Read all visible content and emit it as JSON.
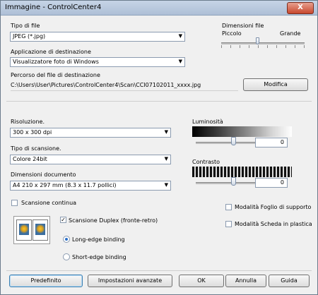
{
  "window": {
    "title": "Immagine - ControlCenter4",
    "close_label": "X"
  },
  "file_type": {
    "label": "Tipo di file",
    "value": "JPEG (*.jpg)"
  },
  "file_size": {
    "label": "Dimensioni file",
    "small": "Piccolo",
    "large": "Grande"
  },
  "target_app": {
    "label": "Applicazione di destinazione",
    "value": "Visualizzatore foto di Windows"
  },
  "dest_path": {
    "label": "Percorso del file di destinazione",
    "value": "C:\\Users\\User\\Pictures\\ControlCenter4\\Scan\\CCI07102011_xxxx.jpg",
    "modify_button": "Modifica"
  },
  "resolution": {
    "label": "Risoluzione.",
    "value": "300 x 300 dpi"
  },
  "scan_type": {
    "label": "Tipo di scansione.",
    "value": "Colore 24bit"
  },
  "doc_size": {
    "label": "Dimensioni documento",
    "value": "A4 210 x 297 mm (8.3 x 11.7 pollici)"
  },
  "brightness": {
    "label": "Luminosità",
    "value": "0",
    "level": 0.5
  },
  "contrast": {
    "label": "Contrasto",
    "value": "0",
    "level": 0.5
  },
  "continuous_scan": {
    "label": "Scansione continua",
    "checked": false
  },
  "duplex": {
    "label": "Scansione Duplex (fronte-retro)",
    "checked": true,
    "long_edge": "Long-edge binding",
    "short_edge": "Short-edge binding"
  },
  "carrier_sheet": {
    "label": "Modalità Foglio di supporto",
    "checked": false
  },
  "plastic_card": {
    "label": "Modalità Scheda in plastica",
    "checked": false
  },
  "buttons": {
    "default": "Predefinito",
    "advanced": "Impostazioni avanzate",
    "ok": "OK",
    "cancel": "Annulla",
    "help": "Guida"
  }
}
